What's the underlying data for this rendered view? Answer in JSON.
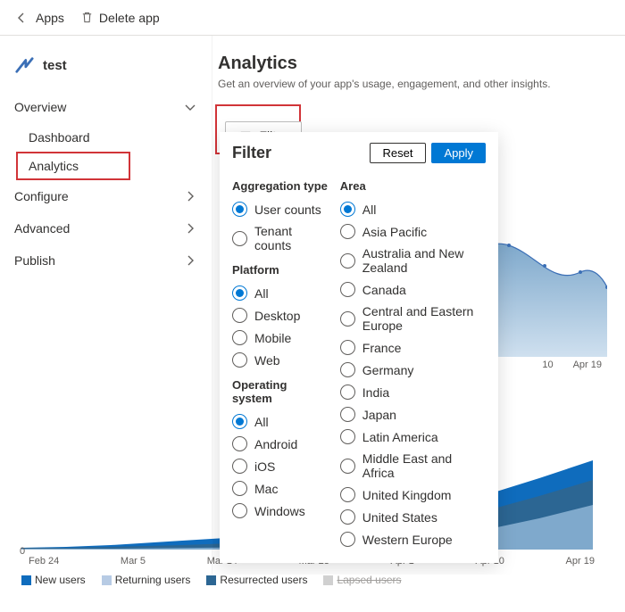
{
  "topbar": {
    "back_label": "Apps",
    "delete_label": "Delete app"
  },
  "app": {
    "name": "test"
  },
  "sidebar": {
    "overview": "Overview",
    "dashboard": "Dashboard",
    "analytics": "Analytics",
    "configure": "Configure",
    "advanced": "Advanced",
    "publish": "Publish"
  },
  "page": {
    "title": "Analytics",
    "subtitle": "Get an overview of your app's usage, engagement, and other insights.",
    "filter_btn": "Filter"
  },
  "filter_panel": {
    "title": "Filter",
    "reset": "Reset",
    "apply": "Apply",
    "aggregation_title": "Aggregation type",
    "aggregation": [
      "User counts",
      "Tenant counts"
    ],
    "aggregation_selected": 0,
    "platform_title": "Platform",
    "platform": [
      "All",
      "Desktop",
      "Mobile",
      "Web"
    ],
    "platform_selected": 0,
    "os_title": "Operating system",
    "os": [
      "All",
      "Android",
      "iOS",
      "Mac",
      "Windows"
    ],
    "os_selected": 0,
    "area_title": "Area",
    "area": [
      "All",
      "Asia Pacific",
      "Australia and New Zealand",
      "Canada",
      "Central and Eastern Europe",
      "France",
      "Germany",
      "India",
      "Japan",
      "Latin America",
      "Middle East and Africa",
      "United Kingdom",
      "United States",
      "Western Europe"
    ],
    "area_selected": 0
  },
  "chart_data": [
    {
      "type": "area",
      "title": "",
      "x": [
        "Feb 24",
        "Mar 5",
        "Mar 14",
        "Mar 23",
        "Apr 1",
        "Apr 10",
        "Apr 19"
      ],
      "values": [
        70,
        58,
        66,
        60,
        72,
        78,
        74,
        80,
        72,
        58,
        64,
        56,
        62
      ],
      "ylim": [
        0,
        100
      ],
      "color": "#6ca2c9"
    },
    {
      "type": "area",
      "title": "",
      "x": [
        "Feb 24",
        "Mar 5",
        "Mar 14",
        "Mar 23",
        "Apr 1",
        "Apr 10",
        "Apr 19"
      ],
      "series": [
        {
          "name": "New users",
          "color": "#0f6cbd",
          "values": [
            5,
            6,
            5,
            7,
            6,
            8,
            9,
            10,
            11,
            12,
            15,
            18,
            22
          ]
        },
        {
          "name": "Returning users",
          "color": "#b7cbe4",
          "values": [
            2,
            2,
            3,
            3,
            3,
            4,
            5,
            6,
            7,
            8,
            10,
            12,
            15
          ]
        },
        {
          "name": "Resurrected users",
          "color": "#2c6693",
          "values": [
            3,
            3,
            4,
            4,
            5,
            5,
            6,
            7,
            7,
            8,
            9,
            10,
            12
          ]
        },
        {
          "name": "Lapsed users",
          "color": "#d0d0d0",
          "values": []
        }
      ],
      "xlabels": [
        "Feb 24",
        "Mar 5",
        "Mar 14",
        "Mar 23",
        "Apr 1",
        "Apr 10",
        "Apr 19"
      ],
      "ylim": [
        0,
        50
      ],
      "y_zero_label": "0"
    }
  ],
  "legend": {
    "new": "New users",
    "returning": "Returning users",
    "resurrected": "Resurrected users",
    "lapsed": "Lapsed users"
  },
  "axis": {
    "y0": "0",
    "x": [
      "Feb 24",
      "Mar 5",
      "Mar 14",
      "Mar 23",
      "Apr 1",
      "Apr 10",
      "Apr 19"
    ],
    "c1x": [
      "10",
      "Apr 19"
    ]
  }
}
